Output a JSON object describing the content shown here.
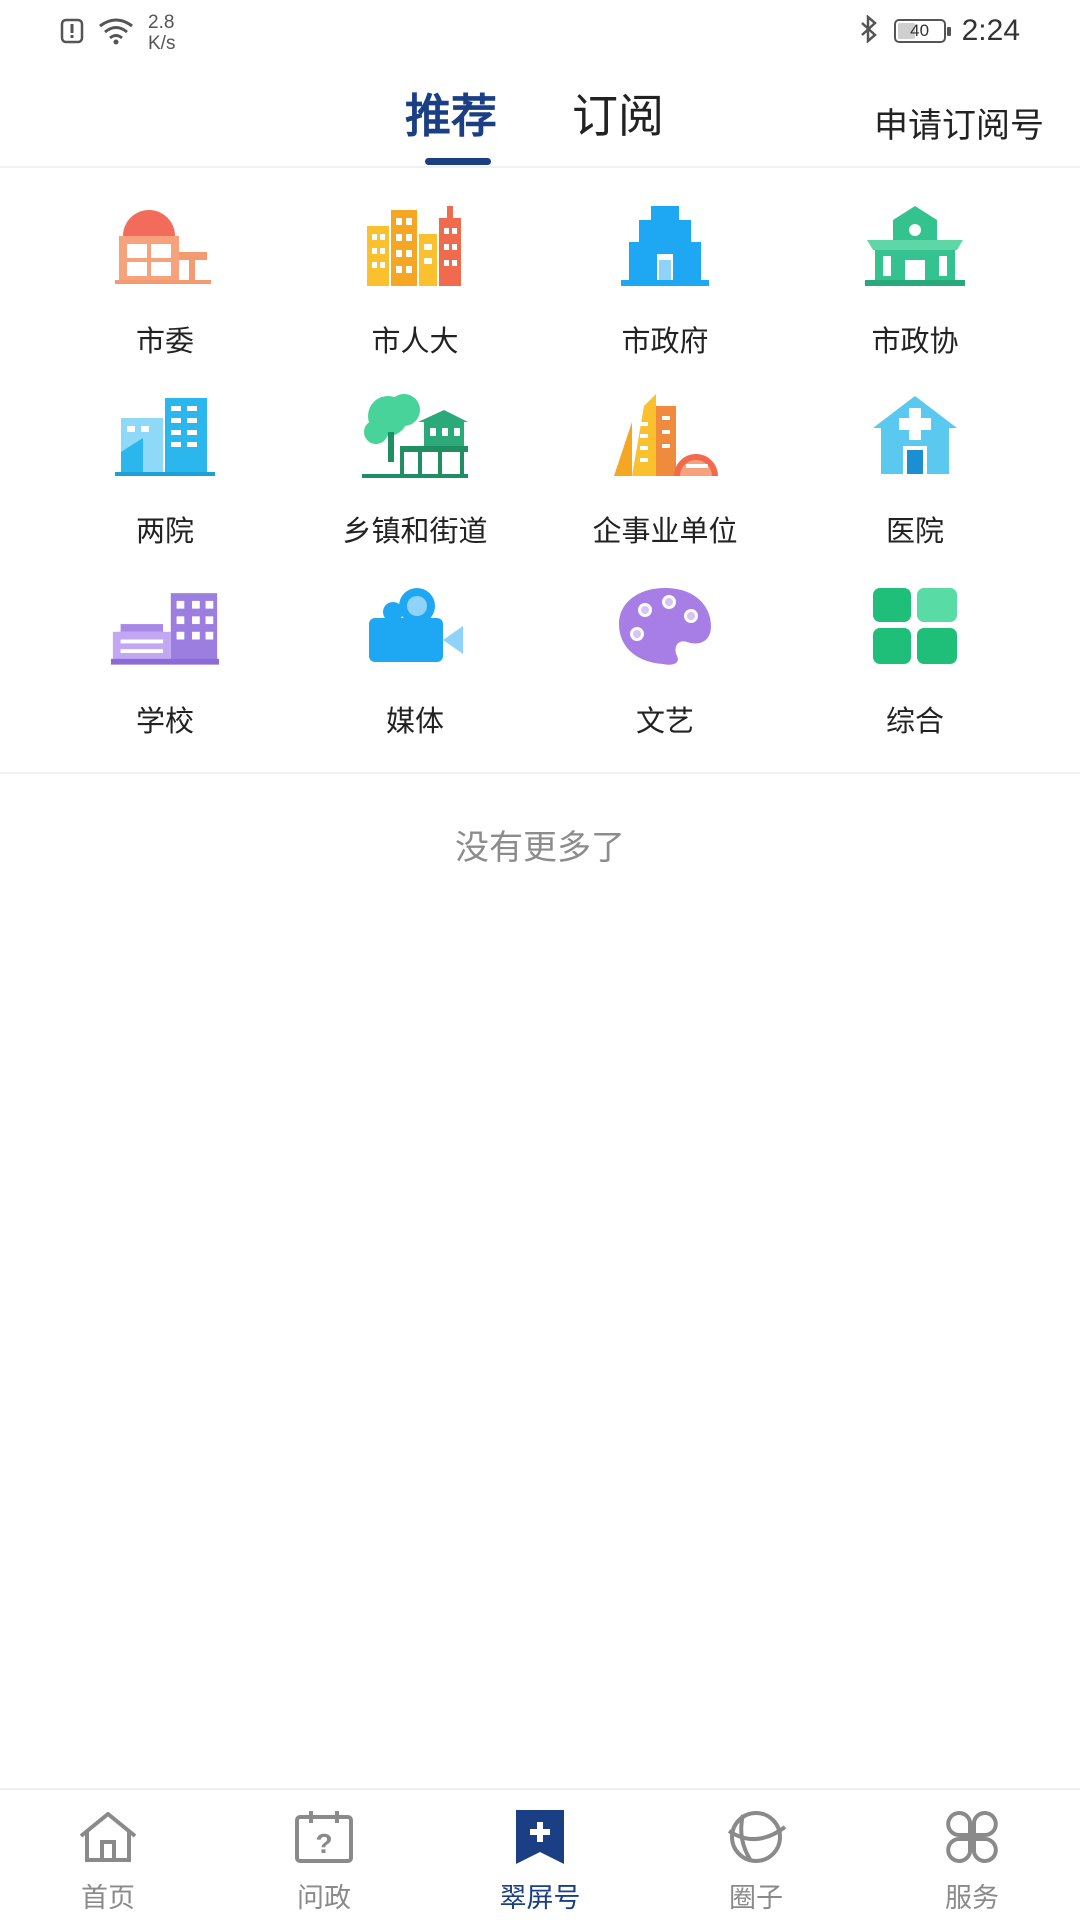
{
  "status_bar": {
    "net_speed_value": "2.8",
    "net_speed_unit": "K/s",
    "battery_level": "40",
    "time": "2:24"
  },
  "header": {
    "tabs": [
      {
        "label": "推荐",
        "active": true
      },
      {
        "label": "订阅",
        "active": false
      }
    ],
    "apply_label": "申请订阅号"
  },
  "categories": [
    {
      "label": "市委",
      "icon": "party-committee-icon"
    },
    {
      "label": "市人大",
      "icon": "city-buildings-icon"
    },
    {
      "label": "市政府",
      "icon": "government-building-icon"
    },
    {
      "label": "市政协",
      "icon": "cppcc-building-icon"
    },
    {
      "label": "两院",
      "icon": "court-buildings-icon"
    },
    {
      "label": "乡镇和街道",
      "icon": "town-street-icon"
    },
    {
      "label": "企事业单位",
      "icon": "enterprise-buildings-icon"
    },
    {
      "label": "医院",
      "icon": "hospital-icon"
    },
    {
      "label": "学校",
      "icon": "school-icon"
    },
    {
      "label": "媒体",
      "icon": "video-camera-icon"
    },
    {
      "label": "文艺",
      "icon": "art-palette-icon"
    },
    {
      "label": "综合",
      "icon": "grid-squares-icon"
    }
  ],
  "footer_text": "没有更多了",
  "bottom_nav": [
    {
      "label": "首页",
      "icon": "home-icon",
      "active": false
    },
    {
      "label": "问政",
      "icon": "question-calendar-icon",
      "active": false
    },
    {
      "label": "翠屏号",
      "icon": "bookmark-plus-icon",
      "active": true
    },
    {
      "label": "圈子",
      "icon": "circle-orbit-icon",
      "active": false
    },
    {
      "label": "服务",
      "icon": "clover-grid-icon",
      "active": false
    }
  ],
  "colors": {
    "accent": "#1b3f84",
    "inactive_nav": "#8a8a8a"
  }
}
